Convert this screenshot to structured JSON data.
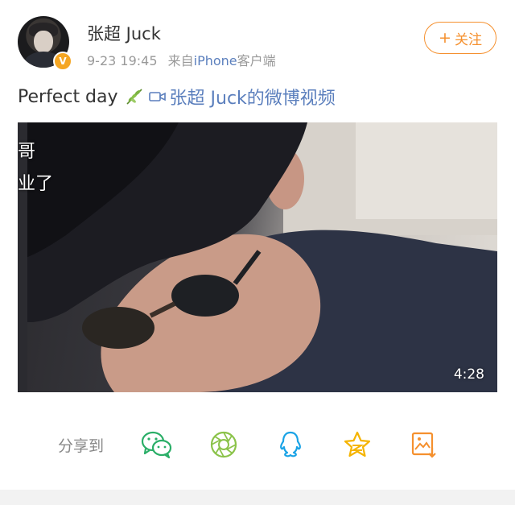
{
  "user": {
    "name": "张超 Juck",
    "verified_badge": "V",
    "time": "9-23 19:45",
    "source_prefix": "来自",
    "device": "iPhone",
    "device_suffix": "客户端"
  },
  "follow_button": {
    "label": "关注",
    "plus": "+"
  },
  "post": {
    "text": "Perfect day",
    "video_link": "张超 Juck的微博视频"
  },
  "video": {
    "subtitle_line1": "哥",
    "subtitle_line2": "业了",
    "duration": "4:28"
  },
  "share": {
    "label": "分享到",
    "targets": [
      "wechat-icon",
      "moments-icon",
      "qq-icon",
      "qzone-icon",
      "save-image-icon"
    ]
  },
  "colors": {
    "link": "#5b7fbd",
    "accent_orange": "#f5902e",
    "wechat_green": "#2aae67",
    "moments_green": "#8bc34a",
    "qq_blue": "#1aa3e6",
    "qzone_yellow": "#f5b400",
    "save_orange": "#f5902e"
  }
}
